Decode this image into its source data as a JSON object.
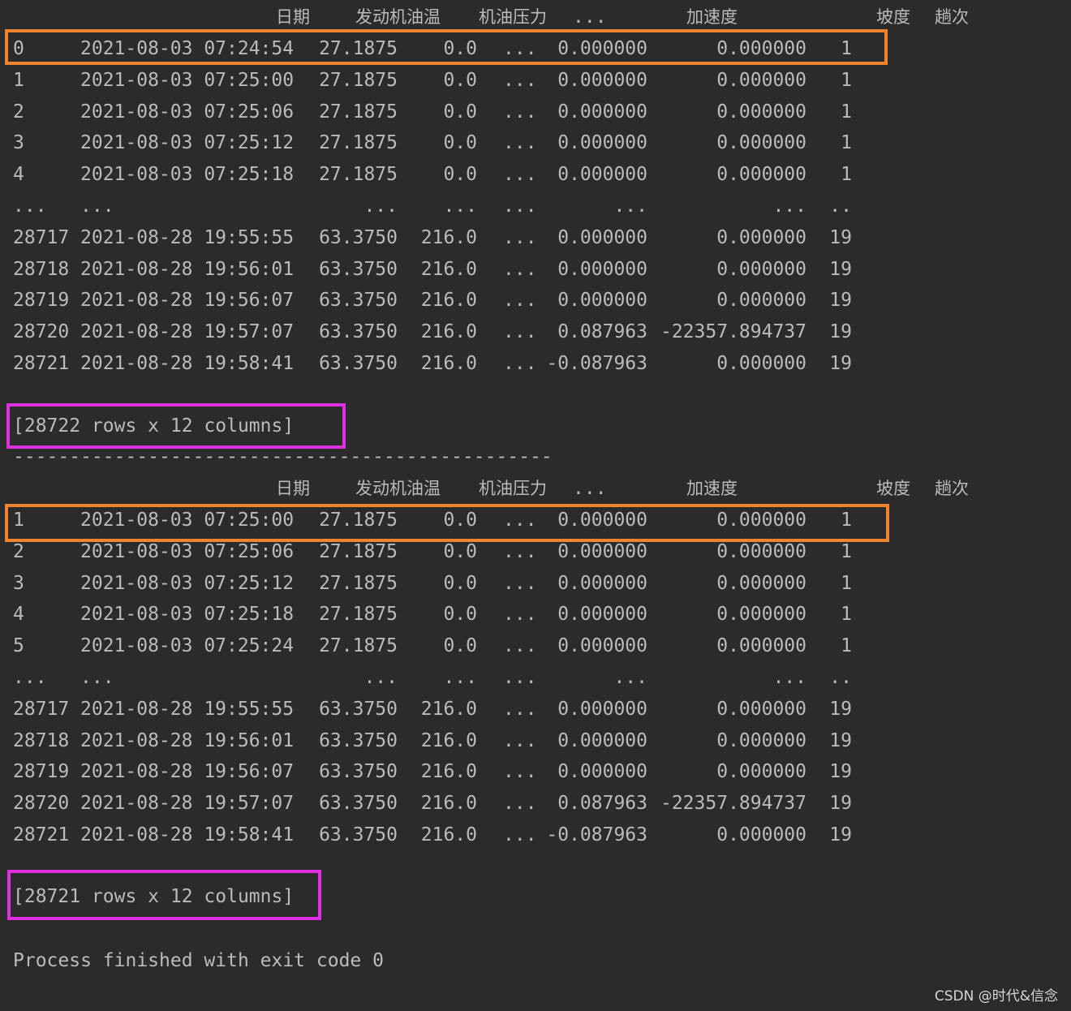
{
  "colors": {
    "background": "#2b2b2b",
    "text": "#bbbbbb",
    "highlight_row": "#f0832f",
    "highlight_summary": "#e02fe0"
  },
  "header": [
    "日期",
    "发动机油温",
    "机油压力",
    "...",
    "加速度",
    "坡度",
    "趟次"
  ],
  "block1": {
    "rows": [
      [
        "0",
        "2021-08-03 07:24:54",
        "27.1875",
        "0.0",
        "...",
        "0.000000",
        "0.000000",
        "1"
      ],
      [
        "1",
        "2021-08-03 07:25:00",
        "27.1875",
        "0.0",
        "...",
        "0.000000",
        "0.000000",
        "1"
      ],
      [
        "2",
        "2021-08-03 07:25:06",
        "27.1875",
        "0.0",
        "...",
        "0.000000",
        "0.000000",
        "1"
      ],
      [
        "3",
        "2021-08-03 07:25:12",
        "27.1875",
        "0.0",
        "...",
        "0.000000",
        "0.000000",
        "1"
      ],
      [
        "4",
        "2021-08-03 07:25:18",
        "27.1875",
        "0.0",
        "...",
        "0.000000",
        "0.000000",
        "1"
      ],
      [
        "...",
        "...",
        "...",
        "...",
        "...",
        "...",
        "...",
        ".."
      ],
      [
        "28717",
        "2021-08-28 19:55:55",
        "63.3750",
        "216.0",
        "...",
        "0.000000",
        "0.000000",
        "19"
      ],
      [
        "28718",
        "2021-08-28 19:56:01",
        "63.3750",
        "216.0",
        "...",
        "0.000000",
        "0.000000",
        "19"
      ],
      [
        "28719",
        "2021-08-28 19:56:07",
        "63.3750",
        "216.0",
        "...",
        "0.000000",
        "0.000000",
        "19"
      ],
      [
        "28720",
        "2021-08-28 19:57:07",
        "63.3750",
        "216.0",
        "...",
        "0.087963",
        "-22357.894737",
        "19"
      ],
      [
        "28721",
        "2021-08-28 19:58:41",
        "63.3750",
        "216.0",
        "...",
        "-0.087963",
        "0.000000",
        "19"
      ]
    ],
    "summary": "[28722 rows x 12 columns]"
  },
  "separator": "------------------------------------------------",
  "block2": {
    "rows": [
      [
        "1",
        "2021-08-03 07:25:00",
        "27.1875",
        "0.0",
        "...",
        "0.000000",
        "0.000000",
        "1"
      ],
      [
        "2",
        "2021-08-03 07:25:06",
        "27.1875",
        "0.0",
        "...",
        "0.000000",
        "0.000000",
        "1"
      ],
      [
        "3",
        "2021-08-03 07:25:12",
        "27.1875",
        "0.0",
        "...",
        "0.000000",
        "0.000000",
        "1"
      ],
      [
        "4",
        "2021-08-03 07:25:18",
        "27.1875",
        "0.0",
        "...",
        "0.000000",
        "0.000000",
        "1"
      ],
      [
        "5",
        "2021-08-03 07:25:24",
        "27.1875",
        "0.0",
        "...",
        "0.000000",
        "0.000000",
        "1"
      ],
      [
        "...",
        "...",
        "...",
        "...",
        "...",
        "...",
        "...",
        ".."
      ],
      [
        "28717",
        "2021-08-28 19:55:55",
        "63.3750",
        "216.0",
        "...",
        "0.000000",
        "0.000000",
        "19"
      ],
      [
        "28718",
        "2021-08-28 19:56:01",
        "63.3750",
        "216.0",
        "...",
        "0.000000",
        "0.000000",
        "19"
      ],
      [
        "28719",
        "2021-08-28 19:56:07",
        "63.3750",
        "216.0",
        "...",
        "0.000000",
        "0.000000",
        "19"
      ],
      [
        "28720",
        "2021-08-28 19:57:07",
        "63.3750",
        "216.0",
        "...",
        "0.087963",
        "-22357.894737",
        "19"
      ],
      [
        "28721",
        "2021-08-28 19:58:41",
        "63.3750",
        "216.0",
        "...",
        "-0.087963",
        "0.000000",
        "19"
      ]
    ],
    "summary": "[28721 rows x 12 columns]"
  },
  "process_message": "Process finished with exit code 0",
  "watermark": "CSDN @时代&信念"
}
